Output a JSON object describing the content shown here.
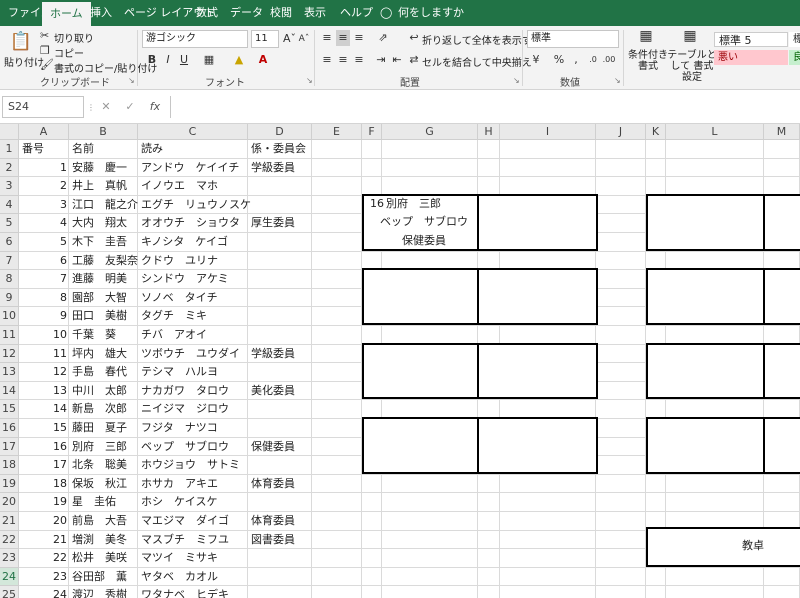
{
  "ribbon_tabs": [
    "ファイル",
    "ホーム",
    "挿入",
    "ページ レイアウト",
    "数式",
    "データ",
    "校閲",
    "表示",
    "ヘルプ",
    "何をしますか"
  ],
  "active_tab": "ホーム",
  "clipboard": {
    "paste": "貼り付け",
    "cut": "切り取り",
    "copy": "コピー",
    "format_painter": "書式のコピー/貼り付け",
    "label": "クリップボード"
  },
  "font": {
    "name": "游ゴシック",
    "size": "11",
    "label": "フォント"
  },
  "alignment": {
    "wrap": "折り返して全体を表示する",
    "merge": "セルを結合して中央揃え",
    "label": "配置"
  },
  "number": {
    "format": "標準",
    "label": "数値"
  },
  "styles": {
    "cond": "条件付き 書式",
    "table": "テーブルとして 書式設定",
    "normal5": "標準 5",
    "standard": "標",
    "bad": "悪い",
    "good": "良"
  },
  "formula_bar": {
    "name_box": "S24",
    "fx": "fx",
    "value": ""
  },
  "columns": [
    "A",
    "B",
    "C",
    "D",
    "E",
    "F",
    "G",
    "H",
    "I",
    "J",
    "K",
    "L",
    "M"
  ],
  "selected_row": "24",
  "header_row": {
    "a": "番号",
    "b": "名前",
    "c": "読み",
    "d": "係・委員会"
  },
  "students": [
    {
      "no": "1",
      "name": "安藤　慶一",
      "yomi": "アンドウ　ケイイチ",
      "role": "学級委員"
    },
    {
      "no": "2",
      "name": "井上　真帆",
      "yomi": "イノウエ　マホ",
      "role": ""
    },
    {
      "no": "3",
      "name": "江口　龍之介",
      "yomi": "エグチ　リュウノスケ",
      "role": ""
    },
    {
      "no": "4",
      "name": "大内　翔太",
      "yomi": "オオウチ　ショウタ",
      "role": "厚生委員"
    },
    {
      "no": "5",
      "name": "木下　圭吾",
      "yomi": "キノシタ　ケイゴ",
      "role": ""
    },
    {
      "no": "6",
      "name": "工藤　友梨奈",
      "yomi": "クドウ　ユリナ",
      "role": ""
    },
    {
      "no": "7",
      "name": "進藤　明美",
      "yomi": "シンドウ　アケミ",
      "role": ""
    },
    {
      "no": "8",
      "name": "園部　大智",
      "yomi": "ソノベ　タイチ",
      "role": ""
    },
    {
      "no": "9",
      "name": "田口　美樹",
      "yomi": "タグチ　ミキ",
      "role": ""
    },
    {
      "no": "10",
      "name": "千葉　葵",
      "yomi": "チバ　アオイ",
      "role": ""
    },
    {
      "no": "11",
      "name": "坪内　雄大",
      "yomi": "ツボウチ　ユウダイ",
      "role": "学級委員"
    },
    {
      "no": "12",
      "name": "手島　春代",
      "yomi": "テシマ　ハルヨ",
      "role": ""
    },
    {
      "no": "13",
      "name": "中川　太郎",
      "yomi": "ナカガワ　タロウ",
      "role": "美化委員"
    },
    {
      "no": "14",
      "name": "新島　次郎",
      "yomi": "ニイジマ　ジロウ",
      "role": ""
    },
    {
      "no": "15",
      "name": "藤田　夏子",
      "yomi": "フジタ　ナツコ",
      "role": ""
    },
    {
      "no": "16",
      "name": "別府　三郎",
      "yomi": "ベップ　サブロウ",
      "role": "保健委員"
    },
    {
      "no": "17",
      "name": "北条　聡美",
      "yomi": "ホウジョウ　サトミ",
      "role": ""
    },
    {
      "no": "18",
      "name": "保坂　秋江",
      "yomi": "ホサカ　アキエ",
      "role": "体育委員"
    },
    {
      "no": "19",
      "name": "星　圭佑",
      "yomi": "ホシ　ケイスケ",
      "role": ""
    },
    {
      "no": "20",
      "name": "前島　大吾",
      "yomi": "マエジマ　ダイゴ",
      "role": "体育委員"
    },
    {
      "no": "21",
      "name": "増渕　美冬",
      "yomi": "マスブチ　ミフユ",
      "role": "図書委員"
    },
    {
      "no": "22",
      "name": "松井　美咲",
      "yomi": "マツイ　ミサキ",
      "role": ""
    },
    {
      "no": "23",
      "name": "谷田部　薫",
      "yomi": "ヤタベ　カオル",
      "role": ""
    },
    {
      "no": "24",
      "name": "渡辺　秀樹",
      "yomi": "ワタナベ　ヒデキ",
      "role": ""
    }
  ],
  "seat_card": {
    "no": "16",
    "name": "別府　三郎",
    "yomi": "ベップ　サブロウ",
    "role": "保健委員"
  },
  "teacher_desk": "教卓",
  "accent_color": "#217346"
}
